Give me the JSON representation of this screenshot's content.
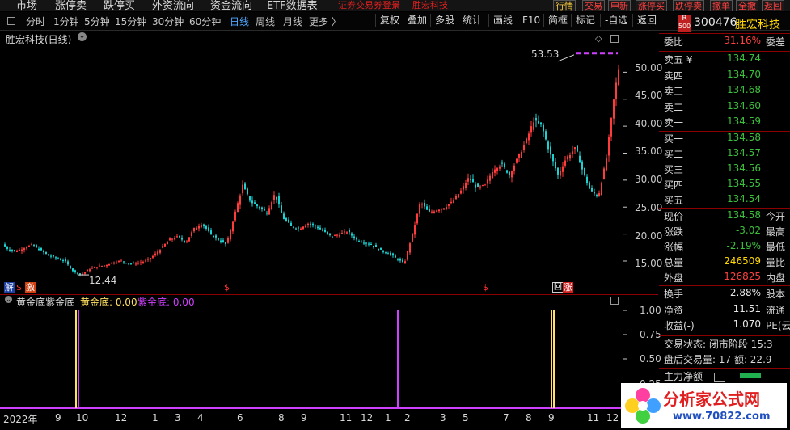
{
  "top_menu": [
    "市场",
    "涨停卖",
    "跌停买",
    "外资流向",
    "资金流向",
    "ETF数据表"
  ],
  "top_marquee": [
    "证券交易",
    "券登景",
    "胜宏科技"
  ],
  "top_right_buttons": [
    "行情",
    "交易",
    "申新",
    "涨停买",
    "跌停卖",
    "撤单",
    "全撤",
    "返回"
  ],
  "periods": [
    "分时",
    "1分钟",
    "5分钟",
    "15分钟",
    "30分钟",
    "60分钟",
    "日线",
    "周线",
    "月线",
    "更多 〉"
  ],
  "active_period": "日线",
  "toolbar_buttons": [
    "复权",
    "叠加",
    "多股",
    "统计",
    "画线",
    "F10",
    "简框",
    "标记",
    "-自选",
    "返回"
  ],
  "chart": {
    "title": "胜宏科技(日线)",
    "high_label": "53.53",
    "low_label": "12.44",
    "y_ticks": [
      "50.00",
      "45.00",
      "40.00",
      "35.00",
      "30.00",
      "25.00",
      "20.00",
      "15.00"
    ],
    "markers": {
      "jie": "解",
      "s": "$",
      "jiao": "激",
      "hui": "回",
      "zhang": "涨"
    }
  },
  "chart_data": {
    "type": "line",
    "title": "胜宏科技(日线)",
    "ylim": [
      12,
      55
    ],
    "x": [
      0,
      10,
      20,
      30,
      40,
      50,
      60,
      70,
      80,
      90,
      100,
      110,
      120,
      130,
      140,
      150,
      160,
      170,
      180,
      190,
      200,
      210,
      220,
      230,
      240,
      250,
      260,
      270,
      280,
      290,
      300,
      310,
      320,
      330,
      340,
      350,
      360,
      370,
      380,
      390,
      400,
      410,
      420,
      430,
      440,
      450,
      460,
      470,
      480,
      490,
      500,
      510,
      520,
      530,
      540,
      550,
      560,
      570,
      580,
      590,
      600,
      610,
      620,
      630,
      640,
      650,
      660,
      670,
      680,
      690,
      700,
      706,
      712,
      720,
      730,
      740,
      750,
      760,
      768
    ],
    "series": [
      {
        "values": [
          18.5,
          17.2,
          16.8,
          17.5,
          18.0,
          17.0,
          16.0,
          15.5,
          15.0,
          13.2,
          12.44,
          13.5,
          14.0,
          14.2,
          14.8,
          15.0,
          14.5,
          14.6,
          15.0,
          16.0,
          17.5,
          19.0,
          19.5,
          18.5,
          21.0,
          22.0,
          20.0,
          19.0,
          18.0,
          23.5,
          29.0,
          26.0,
          25.0,
          24.0,
          27.5,
          23.0,
          21.5,
          21.0,
          22.0,
          21.5,
          20.5,
          19.5,
          20.0,
          20.5,
          19.0,
          18.5,
          18.0,
          17.0,
          16.5,
          15.5,
          14.5,
          20.0,
          26.0,
          24.0,
          24.5,
          25.0,
          26.0,
          28.0,
          30.5,
          28.5,
          29.0,
          32.0,
          33.0,
          31.0,
          34.0,
          37.0,
          41.0,
          40.0,
          35.0,
          31.0,
          34.0,
          35.0,
          36.0,
          32.0,
          28.0,
          27.0,
          34.0,
          46.0,
          53.53,
          50.0,
          45.0,
          42.0,
          47.0,
          43.0,
          38.0,
          42.0,
          44.0
        ]
      }
    ]
  },
  "indicator": {
    "title": "黄金底紫金底",
    "s1_label": "黄金底: 0.00",
    "s2_label": "紫金底: 0.00",
    "y_ticks": [
      "1.00",
      "0.75",
      "0.50",
      "0.25"
    ]
  },
  "x_axis": [
    "2022年",
    "9",
    "10",
    "12",
    "1",
    "3",
    "4",
    "6",
    "8",
    "9",
    "11",
    "12",
    "1",
    "2",
    "3",
    "5",
    "7",
    "8",
    "9",
    "11",
    "12"
  ],
  "quote": {
    "market_tag": "R",
    "market_tag2": "500",
    "code": "300476",
    "name": "胜宏科技",
    "weibi_label": "委比",
    "weibi_value": "31.16%",
    "weicha_label": "委差",
    "sell": [
      {
        "label": "卖五 ¥",
        "price": "134.74"
      },
      {
        "label": "卖四",
        "price": "134.70"
      },
      {
        "label": "卖三",
        "price": "134.68"
      },
      {
        "label": "卖二",
        "price": "134.60"
      },
      {
        "label": "卖一",
        "price": "134.59"
      }
    ],
    "buy": [
      {
        "label": "买一",
        "price": "134.58"
      },
      {
        "label": "买二",
        "price": "134.57"
      },
      {
        "label": "买三",
        "price": "134.56"
      },
      {
        "label": "买四",
        "price": "134.55"
      },
      {
        "label": "买五",
        "price": "134.54"
      }
    ],
    "stats": [
      {
        "label": "现价",
        "value": "134.58",
        "label2": "今开",
        "color": "green"
      },
      {
        "label": "涨跌",
        "value": "-3.02",
        "label2": "最高",
        "color": "green"
      },
      {
        "label": "涨幅",
        "value": "-2.19%",
        "label2": "最低",
        "color": "green"
      },
      {
        "label": "总量",
        "value": "246509",
        "label2": "量比",
        "color": "yellow"
      },
      {
        "label": "外盘",
        "value": "126825",
        "label2": "内盘",
        "color": "red"
      }
    ],
    "stats2": [
      {
        "label": "换手",
        "value": "2.88%",
        "label2": "股本"
      },
      {
        "label": "净资",
        "value": "11.51",
        "label2": "流通"
      },
      {
        "label": "收益(-)",
        "value": "1.070",
        "label2": "PE(云"
      }
    ],
    "trade_status": "交易状态: 闭市阶段 15:3",
    "after_hours": "盘后交易量: 17  额: 22.9",
    "main_net": "主力净额"
  },
  "watermark": {
    "brand": "分析家公式网",
    "url": "www.70822.com"
  },
  "colors": {
    "up": "#ff3c3c",
    "down": "#20d0d0",
    "purple": "#d040ff",
    "yellow": "#ffe060",
    "price_green": "#3cc03c"
  }
}
